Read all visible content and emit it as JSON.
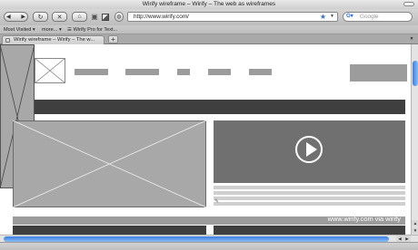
{
  "window": {
    "title": "Wirify wireframe – Wirify – The web as wireframes"
  },
  "toolbar": {
    "back_icon": "back-arrow",
    "forward_icon": "forward-arrow",
    "reload_icon": "reload",
    "stop_icon": "stop",
    "home_icon": "home",
    "url": "http://www.wirify.com/",
    "search_engine": "Google",
    "search_placeholder": "Google"
  },
  "bookmarks": {
    "items": [
      "Most Visited ▾",
      "more... ▾",
      "☰ Wirify Pro for Text..."
    ]
  },
  "tabs": {
    "active_label": "Wirify wireframe – Wirify – The w...",
    "new_tab_label": "+"
  },
  "page": {
    "watermark": "www.wirify.com via wirify",
    "accent_color": "#3b7fe0",
    "wire_gray": "#9c9c9c",
    "wire_dark": "#3f3f3f"
  }
}
